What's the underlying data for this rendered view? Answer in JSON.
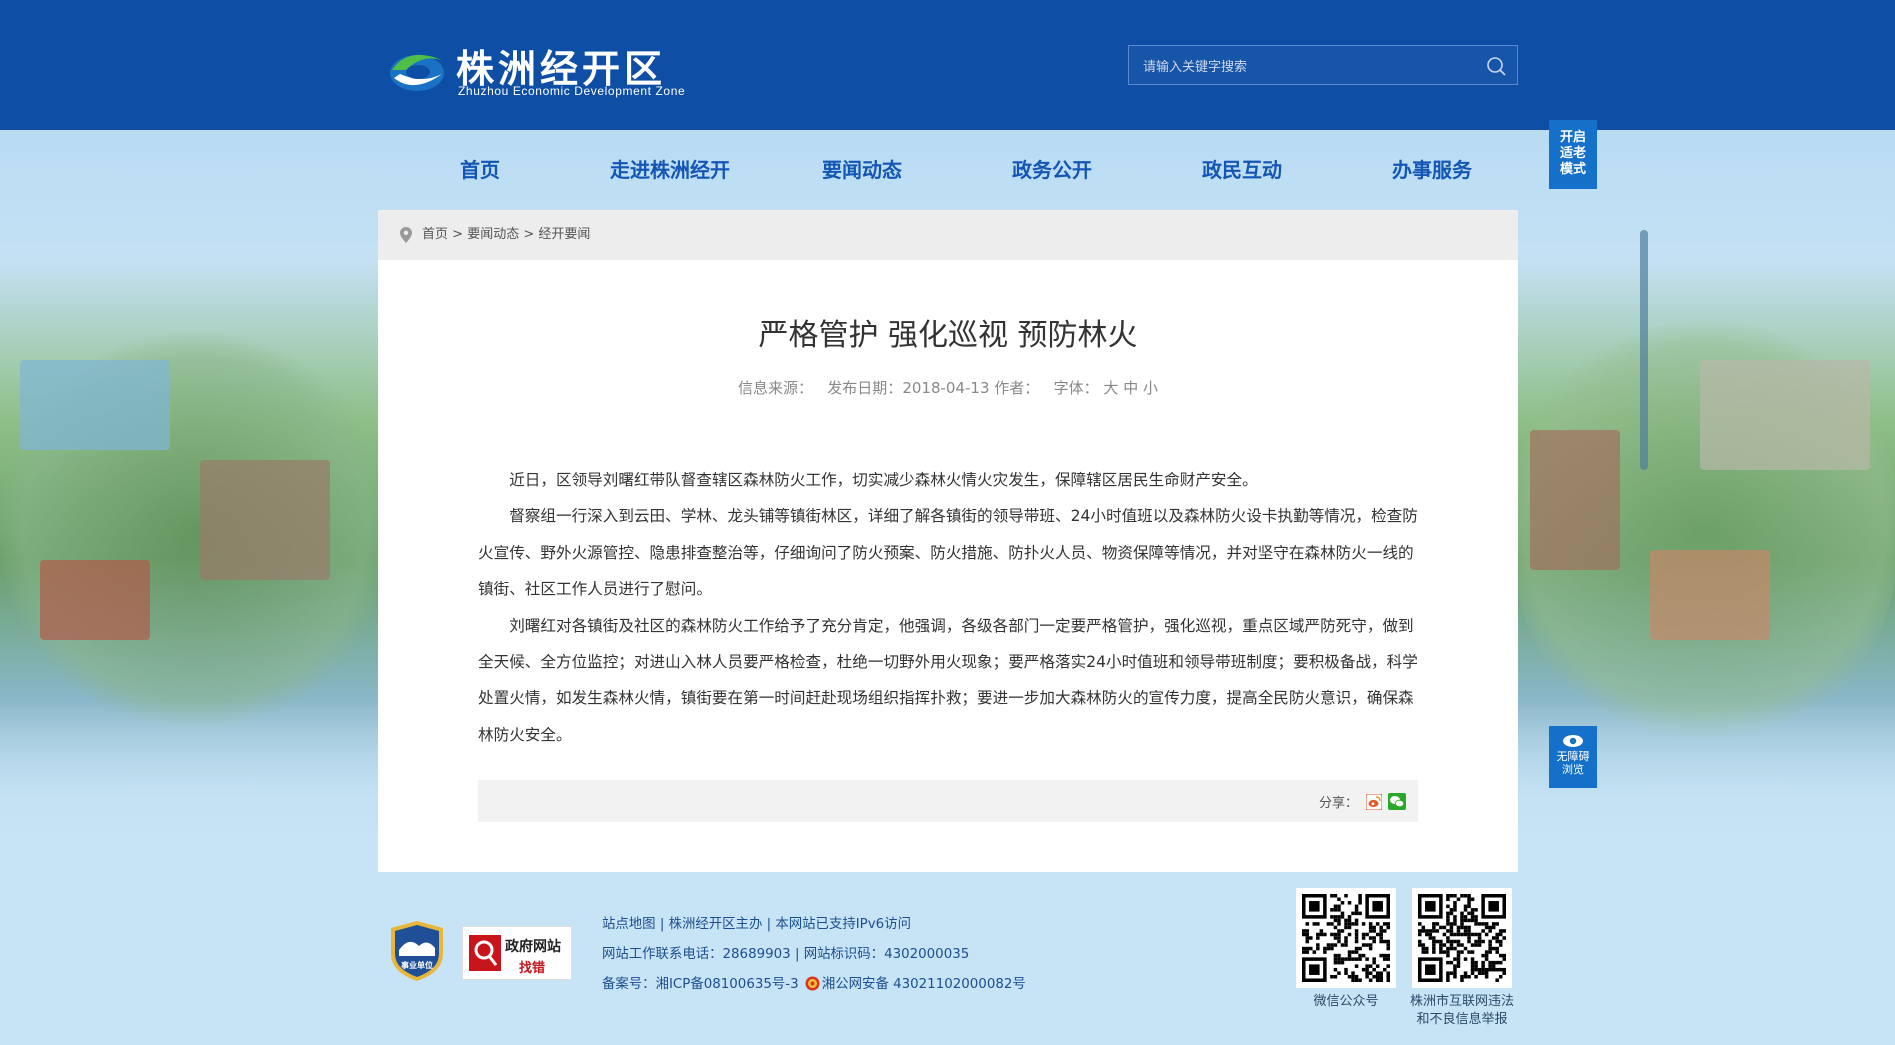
{
  "header": {
    "logo_cn": "株洲经开区",
    "logo_en": "Zhuzhou Economic Development Zone",
    "search_placeholder": "请输入关键字搜索",
    "bg_color": "#0e4fa5"
  },
  "nav": {
    "items": [
      {
        "label": "首页"
      },
      {
        "label": "走进株洲经开"
      },
      {
        "label": "要闻动态"
      },
      {
        "label": "政务公开"
      },
      {
        "label": "政民互动"
      },
      {
        "label": "办事服务"
      }
    ],
    "color": "#1356b3"
  },
  "side": {
    "elder_mode": [
      "开启",
      "适老",
      "模式"
    ],
    "accessible": [
      "无障碍",
      "浏览"
    ]
  },
  "breadcrumb": {
    "home": "首页",
    "sep": ">",
    "level1": "要闻动态",
    "level2": "经开要闻"
  },
  "article": {
    "title": "严格管护 强化巡视 预防林火",
    "source_label": "信息来源：",
    "date_label": "发布日期：",
    "date": "2018-04-13",
    "author_label": "作者：",
    "font_label": "字体：",
    "font_large": "大",
    "font_medium": "中",
    "font_small": "小",
    "paragraphs": [
      "近日，区领导刘曙红带队督查辖区森林防火工作，切实减少森林火情火灾发生，保障辖区居民生命财产安全。",
      "督察组一行深入到云田、学林、龙头铺等镇街林区，详细了解各镇街的领导带班、24小时值班以及森林防火设卡执勤等情况，检查防火宣传、野外火源管控、隐患排查整治等，仔细询问了防火预案、防火措施、防扑火人员、物资保障等情况，并对坚守在森林防火一线的镇街、社区工作人员进行了慰问。",
      "刘曙红对各镇街及社区的森林防火工作给予了充分肯定，他强调，各级各部门一定要严格管护，强化巡视，重点区域严防死守，做到全天候、全方位监控；对进山入林人员要严格检查，杜绝一切野外用火现象；要严格落实24小时值班和领导带班制度；要积极备战，科学处置火情，如发生森林火情，镇街要在第一时间赶赴现场组织指挥扑救；要进一步加大森林防火的宣传力度，提高全民防火意识，确保森林防火安全。"
    ],
    "share_label": "分享："
  },
  "footer": {
    "shield_text": "事业单位",
    "govt_line1": "政府网站",
    "govt_line2": "找错",
    "links": [
      "站点地图",
      "株洲经开区主办",
      "本网站已支持IPv6访问"
    ],
    "link_sep": "|",
    "phone_label": "网站工作联系电话：",
    "phone": "28689903",
    "site_code_label": "网站标识码：",
    "site_code": "4302000035",
    "icp_label": "备案号：",
    "icp": "湘ICP备08100635号-3",
    "police": "湘公网安备 43021102000082号",
    "qr1_label": "微信公众号",
    "qr2_label": [
      "株洲市互联网违法",
      "和不良信息举报"
    ]
  }
}
